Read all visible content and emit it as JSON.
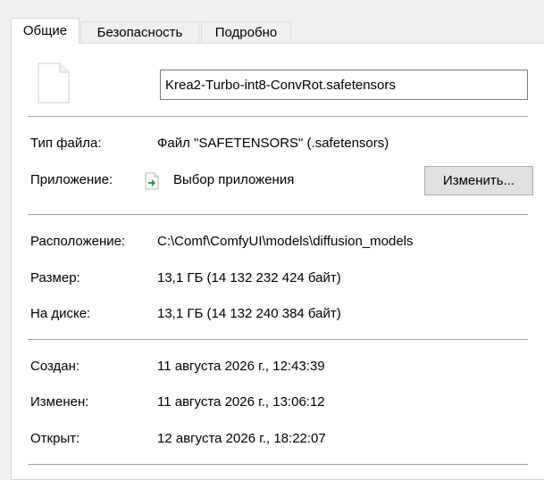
{
  "tabs": [
    {
      "label": "Общие",
      "active": true
    },
    {
      "label": "Безопасность",
      "active": false
    },
    {
      "label": "Подробно",
      "active": false
    }
  ],
  "file": {
    "name": "Krea2-Turbo-int8-ConvRot.safetensors",
    "icon": "blank-document-icon"
  },
  "type": {
    "label": "Тип файла:",
    "value": "Файл \"SAFETENSORS\" (.safetensors)"
  },
  "application": {
    "label": "Приложение:",
    "value": "Выбор приложения",
    "icon": "open-with-icon",
    "change_button": "Изменить..."
  },
  "location": {
    "label": "Расположение:",
    "value": "C:\\Comf\\ComfyUI\\models\\diffusion_models"
  },
  "size": {
    "label": "Размер:",
    "value": "13,1 ГБ (14 132 232 424 байт)"
  },
  "size_on_disk": {
    "label": "На диске:",
    "value": "13,1 ГБ (14 132 240 384 байт)"
  },
  "created": {
    "label": "Создан:",
    "value": "11 августа 2026 г., 12:43:39"
  },
  "modified": {
    "label": "Изменен:",
    "value": "11 августа 2026 г., 13:06:12"
  },
  "accessed": {
    "label": "Открыт:",
    "value": "12 августа 2026 г., 18:22:07"
  }
}
